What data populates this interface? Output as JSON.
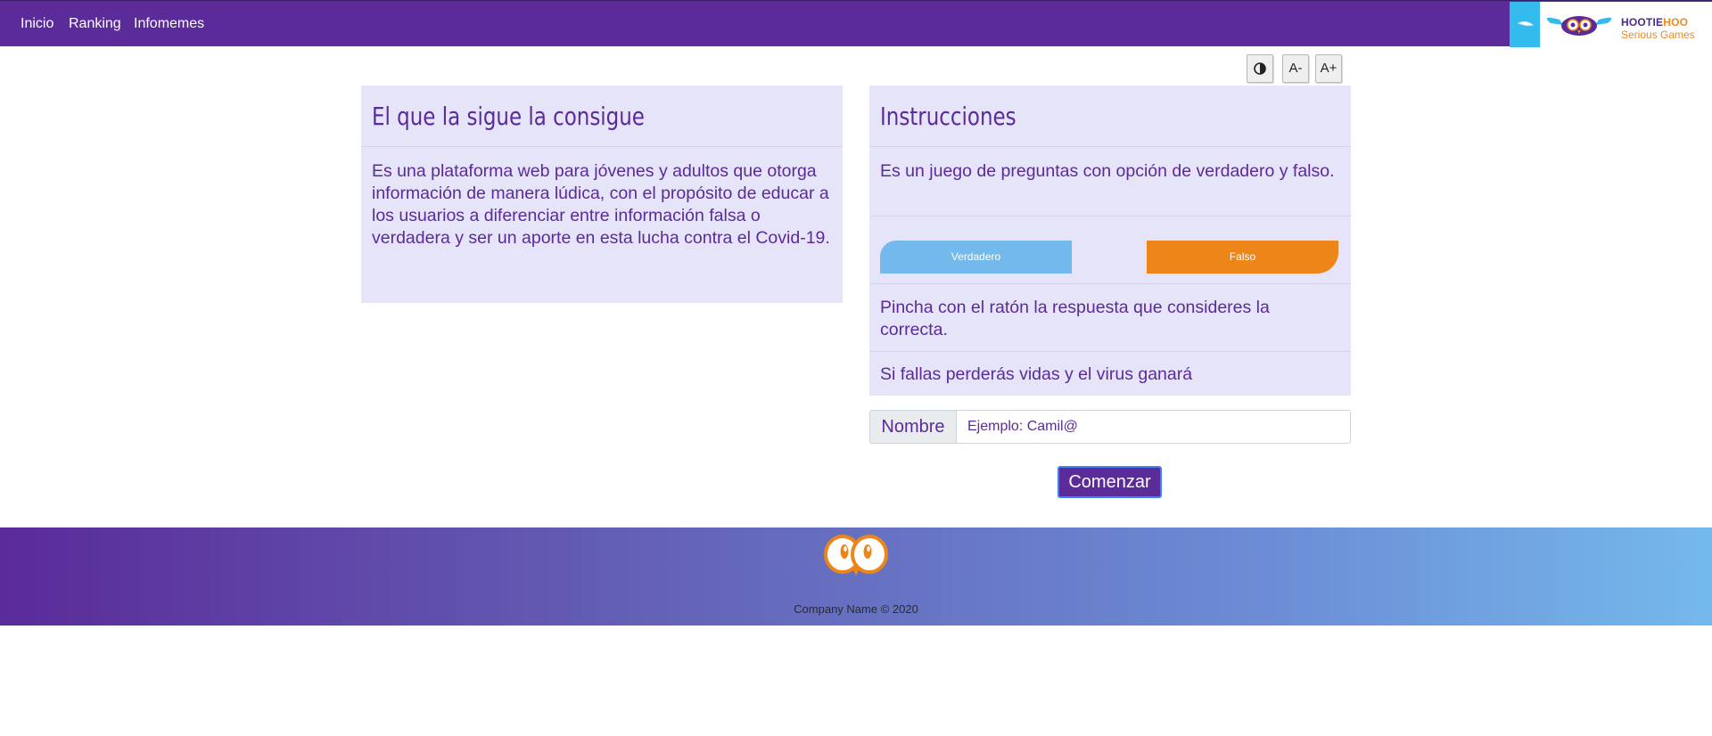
{
  "nav": {
    "links": [
      "Inicio",
      "Ranking",
      "Infomemes"
    ]
  },
  "logo": {
    "brand_part1": "HOOTIE",
    "brand_part2": "HOO",
    "subtitle": "Serious Games"
  },
  "accessibility": {
    "contrast_icon": "contrast-icon",
    "decrease_label": "A-",
    "increase_label": "A+"
  },
  "about_card": {
    "title": "El que la sigue la consigue",
    "text": "Es una plataforma web para jóvenes y adultos que otorga información de manera lúdica, con el propósito de educar a los usuarios a diferenciar entre información falsa o verdadera y ser un aporte en esta lucha contra el Covid-19."
  },
  "instructions_card": {
    "title": "Instrucciones",
    "intro": "Es un juego de preguntas con opción de verdadero y falso.",
    "true_label": "Verdadero",
    "false_label": "Falso",
    "click_hint": "Pincha con el ratón la respuesta que consideres la correcta.",
    "lose_hint": "Si fallas perderás vidas y el virus ganará"
  },
  "form": {
    "name_label": "Nombre",
    "name_placeholder": "Ejemplo: Camil@",
    "name_value": "",
    "start_label": "Comenzar"
  },
  "footer": {
    "copyright": "Company Name © 2020"
  },
  "colors": {
    "primary": "#5a2b99",
    "card_bg": "#e5e4f8",
    "true_blue": "#74b9ec",
    "false_orange": "#ee8518"
  }
}
